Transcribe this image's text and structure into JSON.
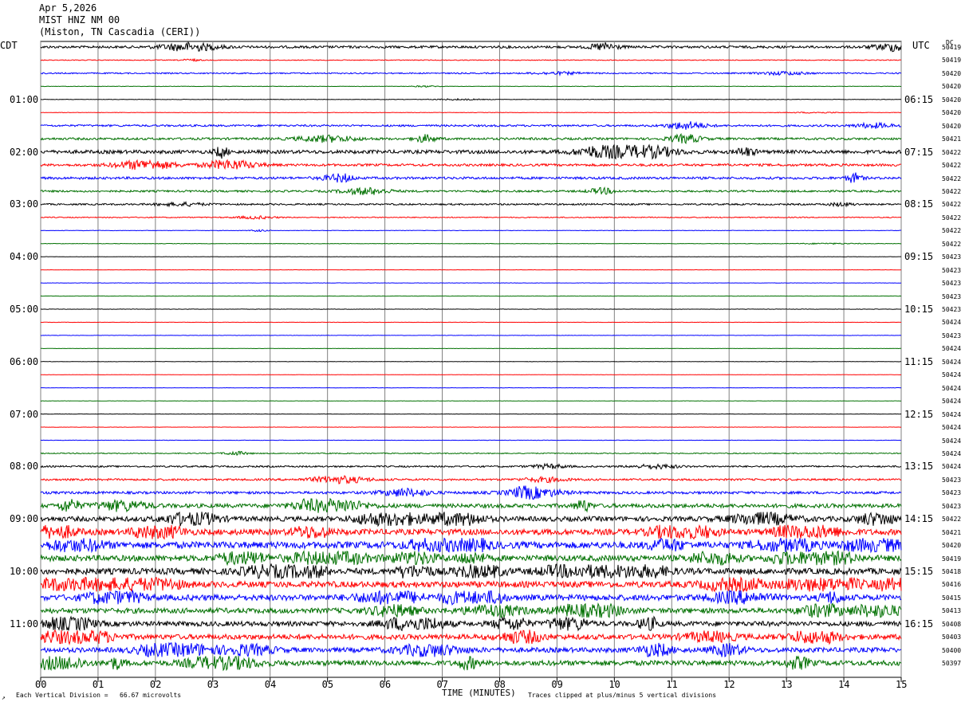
{
  "header": {
    "date": "Apr 5,2026",
    "station": "MIST HNZ NM 00",
    "location": "(Miston, TN Cascadia (CERI))"
  },
  "labels": {
    "left_tz": "CDT",
    "right_tz": "UTC",
    "dc": "DC",
    "corner_mark": "↗"
  },
  "footer": {
    "scale": "Each Vertical Division =   66.67 microvolts",
    "xlabel": "TIME (MINUTES)",
    "clip": "Traces clipped at plus/minus 5 vertical divisions"
  },
  "colors": {
    "trace_cycle": [
      "#000000",
      "#ff0000",
      "#0000ff",
      "#007000"
    ],
    "grid": "#808080"
  },
  "chart_data": {
    "type": "helicorder",
    "x_ticks": [
      "00",
      "01",
      "02",
      "03",
      "04",
      "05",
      "06",
      "07",
      "08",
      "09",
      "10",
      "11",
      "12",
      "13",
      "14",
      "15"
    ],
    "xlim": [
      0,
      15
    ],
    "left_hour_labels": [
      "01:00",
      "02:00",
      "03:00",
      "04:00",
      "05:00",
      "06:00",
      "07:00",
      "08:00",
      "09:00",
      "10:00",
      "11:00"
    ],
    "right_hour_labels": [
      "06:15",
      "07:15",
      "08:15",
      "09:15",
      "10:15",
      "11:15",
      "12:15",
      "13:15",
      "14:15",
      "15:15",
      "16:15"
    ],
    "dc_values": [
      "50419",
      "50419",
      "50420",
      "50420",
      "50420",
      "50420",
      "50420",
      "50421",
      "50422",
      "50422",
      "50422",
      "50422",
      "50422",
      "50422",
      "50422",
      "50422",
      "50423",
      "50423",
      "50423",
      "50423",
      "50423",
      "50424",
      "50423",
      "50424",
      "50424",
      "50424",
      "50424",
      "50424",
      "50424",
      "50424",
      "50424",
      "50424",
      "50424",
      "50423",
      "50423",
      "50423",
      "50422",
      "50421",
      "50420",
      "50419",
      "50418",
      "50416",
      "50415",
      "50413",
      "50408",
      "50403",
      "50400",
      "50397"
    ],
    "trace_activity": [
      1.5,
      0.5,
      0.8,
      0.3,
      0.3,
      0.3,
      1.2,
      1.4,
      2.2,
      1.5,
      1.5,
      1.2,
      1.0,
      0.6,
      0.3,
      0.3,
      0.2,
      0.2,
      0.2,
      0.2,
      0.2,
      0.2,
      0.2,
      0.2,
      0.2,
      0.2,
      0.2,
      0.2,
      0.2,
      0.2,
      0.2,
      0.6,
      1.0,
      1.2,
      1.6,
      2.5,
      3.0,
      3.6,
      4.2,
      3.6,
      3.8,
      3.8,
      3.6,
      3.2,
      3.0,
      3.2,
      3.0,
      3.2
    ]
  }
}
